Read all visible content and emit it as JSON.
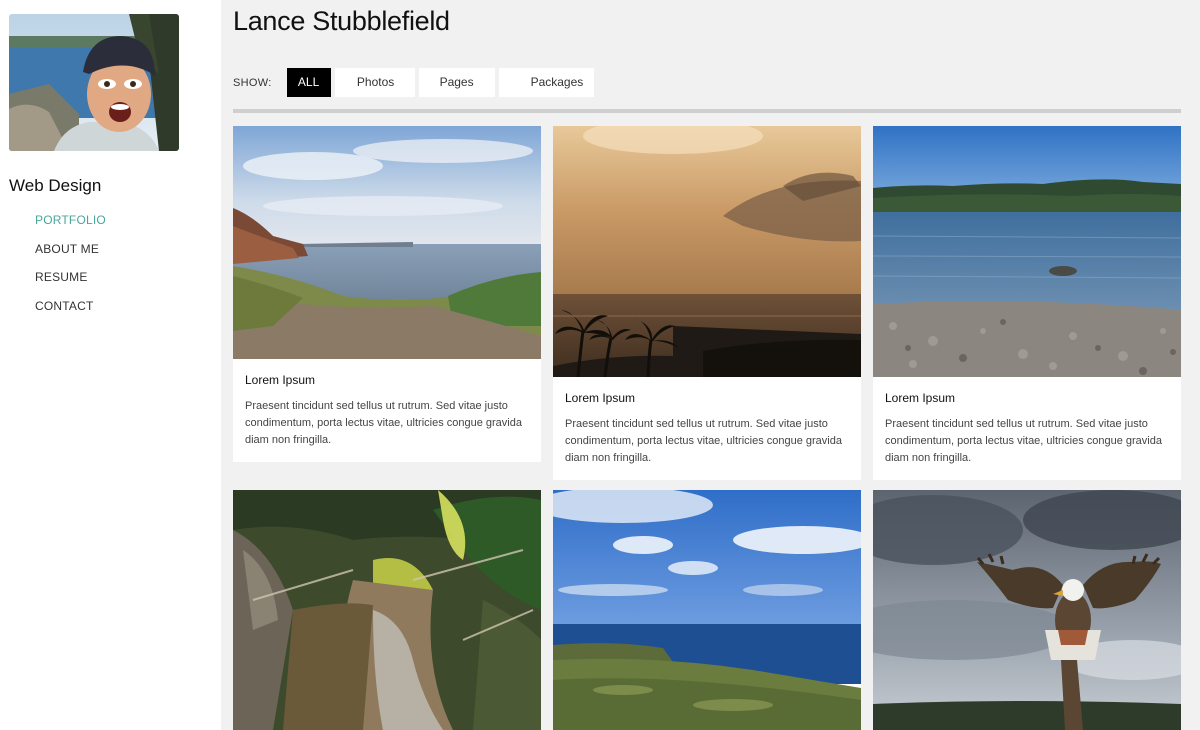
{
  "sidebar": {
    "site_title": "Web Design",
    "nav": [
      "PORTFOLIO",
      "ABOUT ME",
      "RESUME",
      "CONTACT"
    ],
    "active_color": "#4aa59a"
  },
  "header": {
    "title": "Lance Stubblefield"
  },
  "filter": {
    "label": "SHOW:",
    "buttons": [
      "ALL",
      "Photos",
      "Pages",
      "Packages"
    ],
    "active": "ALL"
  },
  "cards": [
    {
      "title": "Lorem Ipsum",
      "text": "Praesent tincidunt sed tellus ut rutrum. Sed vitae justo condimentum, porta lectus vitae, ultricies congue gravida diam non fringilla.",
      "image": "coastal-cliff-path"
    },
    {
      "title": "Lorem Ipsum",
      "text": "Praesent tincidunt sed tellus ut rutrum. Sed vitae justo condimentum, porta lectus vitae, ultricies congue gravida diam non fringilla.",
      "image": "sunset-palms"
    },
    {
      "title": "Lorem Ipsum",
      "text": "Praesent tincidunt sed tellus ut rutrum. Sed vitae justo condimentum, porta lectus vitae, ultricies congue gravida diam non fringilla.",
      "image": "lake-pebble-beach"
    },
    {
      "title": "",
      "text": "",
      "image": "forest-creek"
    },
    {
      "title": "",
      "text": "",
      "image": "ocean-coast-sky"
    },
    {
      "title": "",
      "text": "",
      "image": "eagle-sculpture"
    }
  ]
}
